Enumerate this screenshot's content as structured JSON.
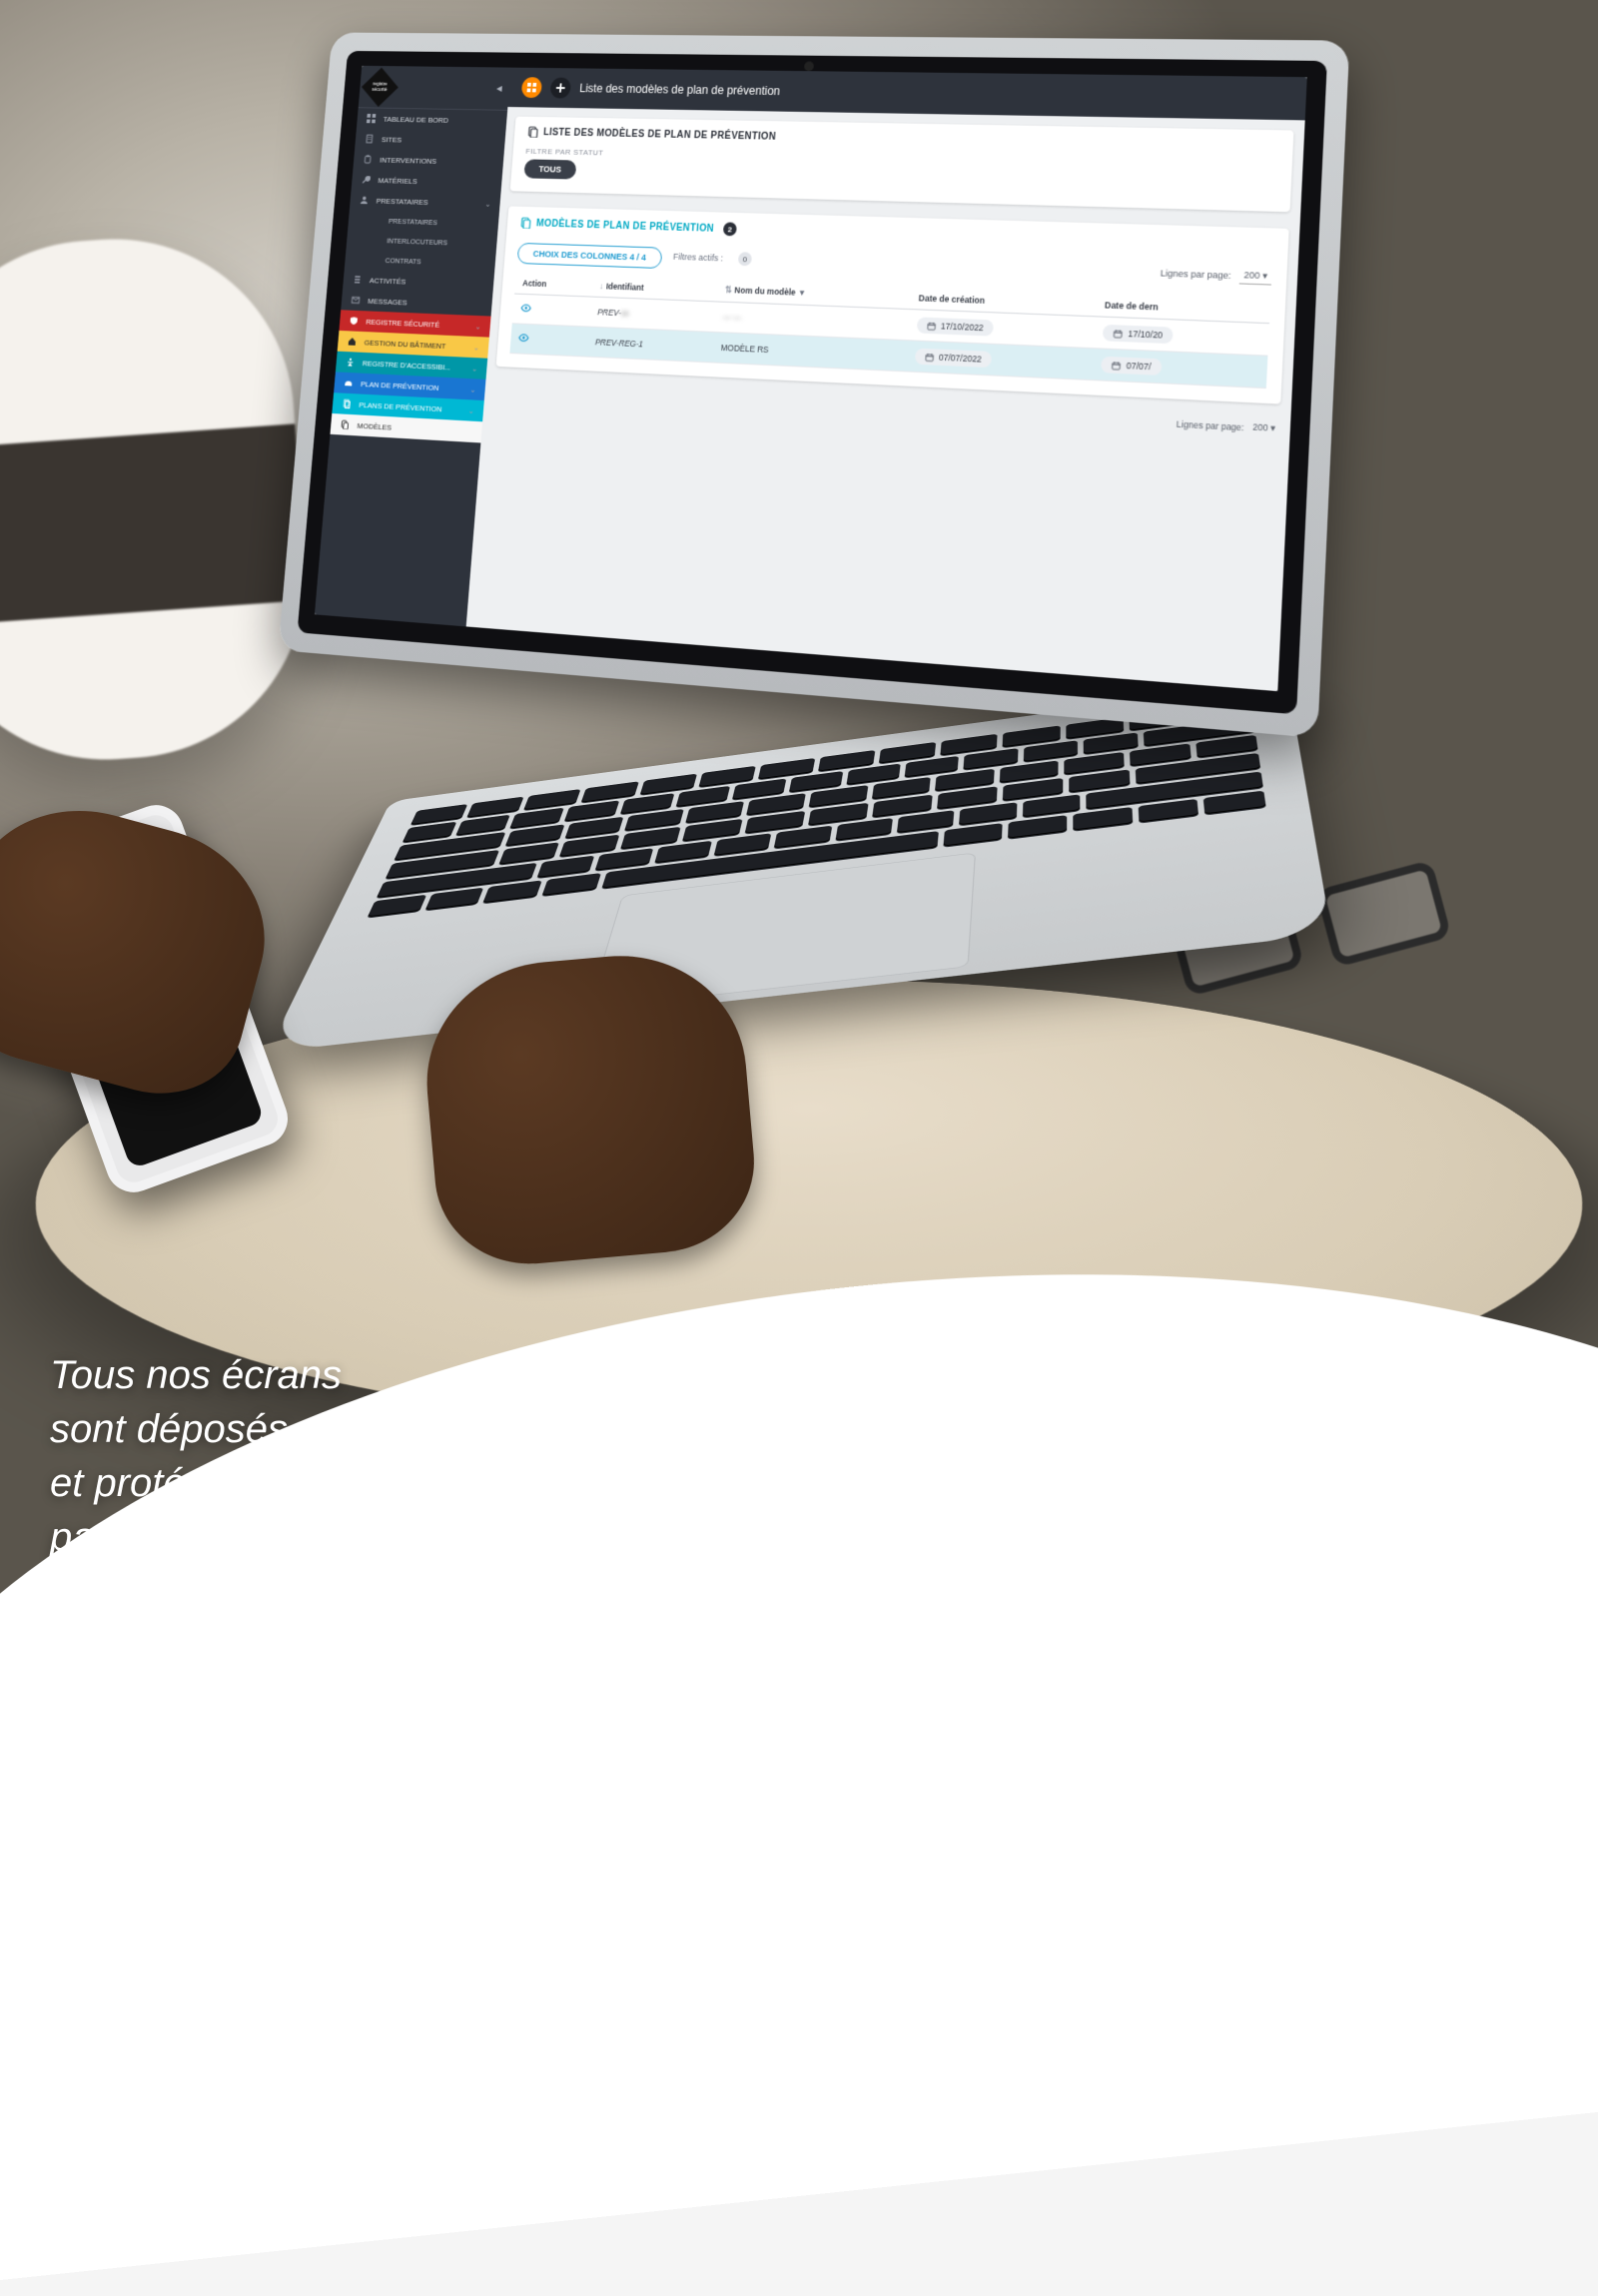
{
  "caption": "Tous nos écrans\nsont déposés\net protégés\npar l'INPI",
  "topbar": {
    "title": "Liste des modèles de plan de prévention"
  },
  "sidebar": {
    "items": [
      {
        "icon": "grid",
        "label": "TABLEAU DE BORD"
      },
      {
        "icon": "building",
        "label": "SITES"
      },
      {
        "icon": "clipboard",
        "label": "INTERVENTIONS"
      },
      {
        "icon": "wrench",
        "label": "MATÉRIELS"
      },
      {
        "icon": "user",
        "label": "PRESTATAIRES",
        "chev": true
      },
      {
        "icon": "",
        "label": "PRESTATAIRES",
        "sub": true
      },
      {
        "icon": "",
        "label": "INTERLOCUTEURS",
        "sub": true
      },
      {
        "icon": "",
        "label": "CONTRATS",
        "sub": true
      },
      {
        "icon": "list",
        "label": "ACTIVITÉS"
      },
      {
        "icon": "mail",
        "label": "MESSAGES"
      }
    ],
    "colored": [
      {
        "cls": "sec-red",
        "icon": "shield",
        "label": "REGISTRE SÉCURITÉ",
        "chev": true
      },
      {
        "cls": "sec-yellow",
        "icon": "home",
        "label": "GESTION DU BÂTIMENT",
        "chev": true
      },
      {
        "cls": "sec-teal",
        "icon": "access",
        "label": "REGISTRE D'ACCESSIBI...",
        "chev": true
      },
      {
        "cls": "sec-blue",
        "icon": "helmet",
        "label": "PLAN DE PRÉVENTION",
        "chev": true
      },
      {
        "cls": "sec-cyan",
        "icon": "docs",
        "label": "PLANS DE PRÉVENTION",
        "chev": true
      },
      {
        "cls": "sec-white",
        "icon": "copy",
        "label": "MODÈLES"
      }
    ]
  },
  "panel": {
    "heading": "LISTE DES MODÈLES DE PLAN DE PRÉVENTION",
    "filter_label": "FILTRE PAR STATUT",
    "filter_all": "TOUS",
    "sub_heading": "MODÈLES DE PLAN DE PRÉVENTION",
    "sub_count": "2",
    "columns_button": "CHOIX DES COLONNES 4 / 4",
    "filters_active_label": "Filtres actifs :",
    "filters_active_count": "0",
    "rows_per_page_label": "Lignes par page:",
    "rows_per_page_value": "200"
  },
  "table": {
    "headers": {
      "action": "Action",
      "identifiant": "Identifiant",
      "nom": "Nom du modèle",
      "date_creation": "Date de création",
      "date_dern": "Date de dern"
    },
    "rows": [
      {
        "id": "PREV-",
        "id_suffix_blur": "xx",
        "nom_blur": "— —",
        "date_c": "17/10/2022",
        "date_m": "17/10/20"
      },
      {
        "id": "PREV-REG-1",
        "nom": "MODÈLE RS",
        "date_c": "07/07/2022",
        "date_m": "07/07/",
        "hl": true
      }
    ]
  }
}
